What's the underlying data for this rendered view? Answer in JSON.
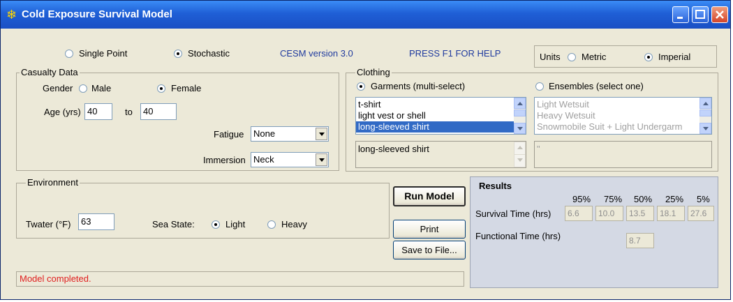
{
  "window": {
    "title": "Cold Exposure Survival Model"
  },
  "mode": {
    "single_point": "Single Point",
    "stochastic": "Stochastic",
    "selected": "stochastic"
  },
  "info": {
    "version": "CESM version  3.0",
    "help": "PRESS F1 FOR HELP"
  },
  "units": {
    "label": "Units",
    "metric": "Metric",
    "imperial": "Imperial",
    "selected": "imperial"
  },
  "casualty": {
    "legend": "Casualty Data",
    "gender_label": "Gender",
    "male": "Male",
    "female": "Female",
    "age_label": "Age (yrs)",
    "age_from": "40",
    "to_label": "to",
    "age_to": "40",
    "fatigue_label": "Fatigue",
    "fatigue_value": "None",
    "immersion_label": "Immersion",
    "immersion_value": "Neck"
  },
  "clothing": {
    "legend": "Clothing",
    "garments_label": "Garments (multi-select)",
    "ensembles_label": "Ensembles (select one)",
    "garments": [
      "t-shirt",
      "light vest or shell",
      "long-sleeved shirt"
    ],
    "selected_garment": "long-sleeved shirt",
    "ensembles": [
      "Light Wetsuit",
      "Heavy Wetsuit",
      "Snowmobile Suit + Light Undergarm"
    ],
    "ensemble_selected": "\""
  },
  "environment": {
    "legend": "Environment",
    "twater_label": "Twater (°F)",
    "twater_value": "63",
    "seastate_label": "Sea State:",
    "light": "Light",
    "heavy": "Heavy"
  },
  "buttons": {
    "run": "Run Model",
    "print": "Print",
    "save": "Save to File..."
  },
  "results": {
    "title": "Results",
    "percentiles": [
      "95%",
      "75%",
      "50%",
      "25%",
      "5%"
    ],
    "survival_label": "Survival Time (hrs)",
    "survival_values": [
      "6.6",
      "10.0",
      "13.5",
      "18.1",
      "27.6"
    ],
    "functional_label": "Functional Time (hrs)",
    "functional_value": "8.7"
  },
  "status": {
    "message": "Model completed.",
    "color": "#e02020"
  }
}
